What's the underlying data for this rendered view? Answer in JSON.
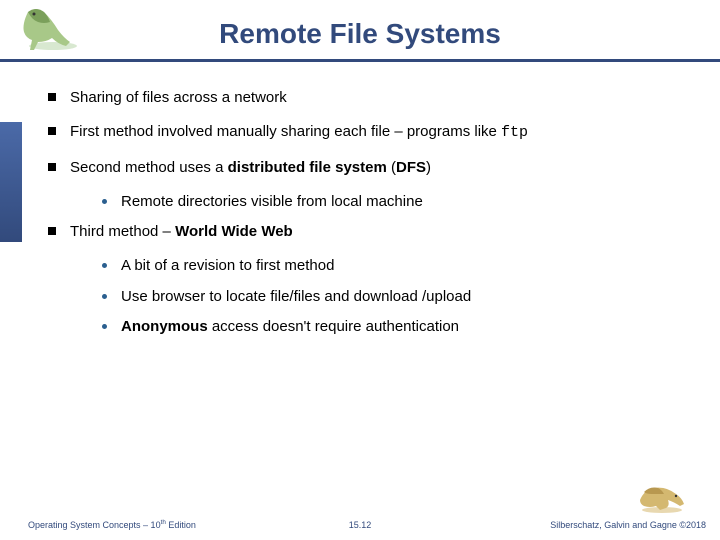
{
  "title": "Remote File Systems",
  "bullets": {
    "b1": "Sharing of files across a network",
    "b2_pre": "First method involved manually sharing each file – programs like ",
    "b2_code": "ftp",
    "b3_pre": "Second method uses a ",
    "b3_bold": "distributed file system",
    "b3_post1": " (",
    "b3_dfs": "DFS",
    "b3_post2": ")",
    "b3_sub1": "Remote directories visible from local machine",
    "b4_pre": "Third method – ",
    "b4_bold": "World Wide Web",
    "b4_sub1": "A bit of a revision to first method",
    "b4_sub2": "Use browser to locate file/files and download /upload",
    "b4_sub3_bold": "Anonymous",
    "b4_sub3_post": " access doesn't require authentication"
  },
  "footer": {
    "left_pre": "Operating System Concepts – 10",
    "left_sup": "th",
    "left_post": " Edition",
    "center": "15.12",
    "right": "Silberschatz, Galvin and Gagne ©2018"
  }
}
